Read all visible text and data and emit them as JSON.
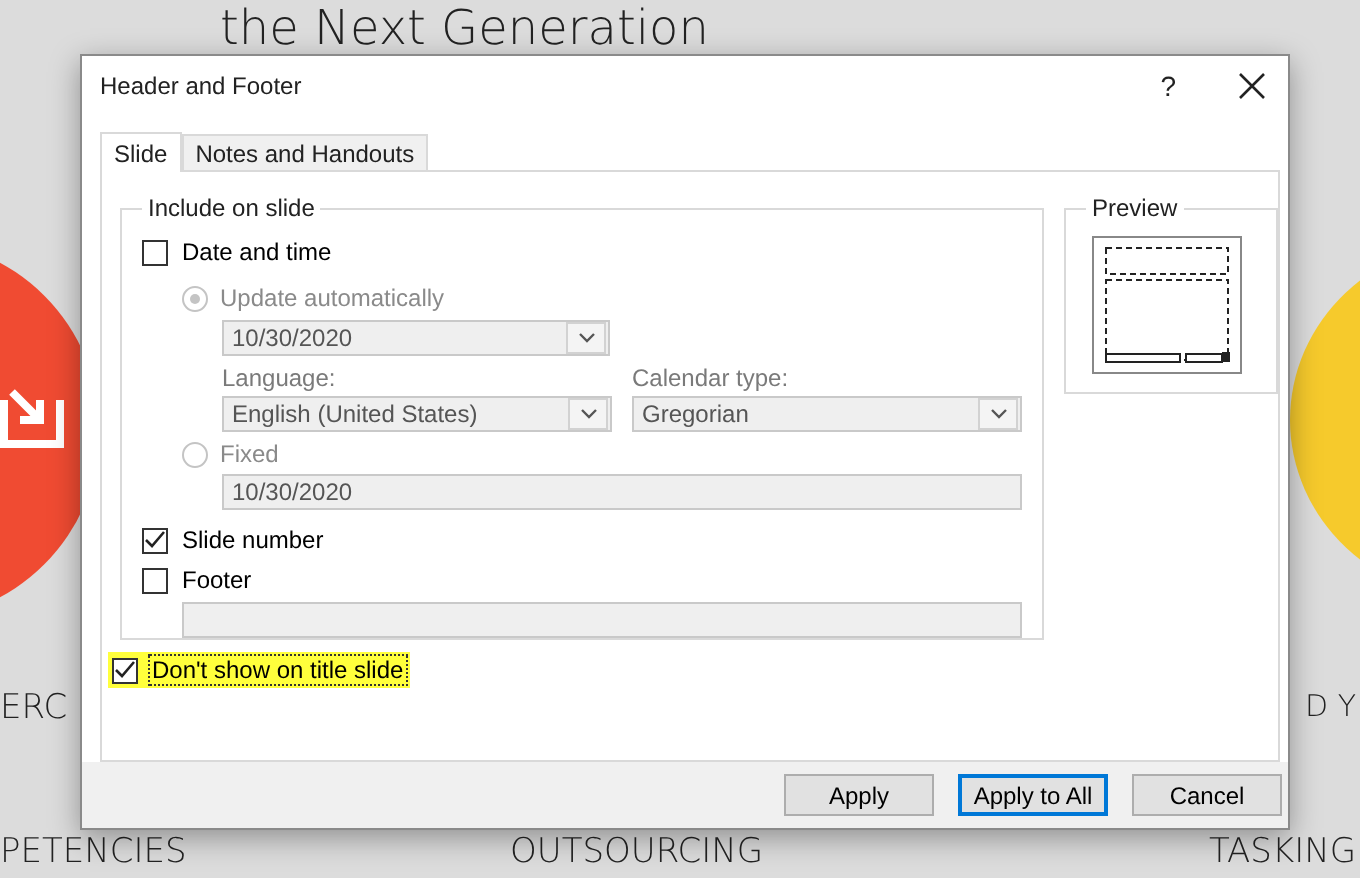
{
  "slide": {
    "title": "the Next Generation",
    "circles": [
      {
        "kind": "left",
        "color": "#f04b32"
      },
      {
        "kind": "right",
        "color": "#f6ca2c"
      }
    ],
    "texts": [
      {
        "kind": "left_top",
        "text": "ERC"
      },
      {
        "kind": "left_bottom",
        "text": "PETENCIES"
      },
      {
        "kind": "center_bottom",
        "text": "OUTSOURCING"
      },
      {
        "kind": "right_top",
        "text": "D Y"
      },
      {
        "kind": "right_bottom",
        "text": "TASKING"
      }
    ]
  },
  "dialog": {
    "title": "Header and Footer",
    "help": "?",
    "tabs": [
      {
        "label": "Slide",
        "selected": true
      },
      {
        "label": "Notes and Handouts",
        "selected": false
      }
    ],
    "include_group": {
      "title": "Include on slide",
      "date_and_time": {
        "label": "Date and time",
        "checked": false
      },
      "update_automatically": {
        "label": "Update automatically",
        "selected": true
      },
      "date_format": {
        "value": "10/30/2020"
      },
      "language": {
        "label": "Language:",
        "value": "English (United States)"
      },
      "calendar_type": {
        "label": "Calendar type:",
        "value": "Gregorian"
      },
      "fixed": {
        "label": "Fixed",
        "selected": false
      },
      "fixed_date": {
        "value": "10/30/2020"
      },
      "slide_number": {
        "label": "Slide number",
        "checked": true
      },
      "footer": {
        "label": "Footer",
        "checked": false
      }
    },
    "preview": {
      "title": "Preview"
    },
    "dont_show_on_title_slide": {
      "label": "Don't show on title slide",
      "checked": true,
      "highlighted": true
    },
    "buttons": [
      {
        "label": "Apply",
        "default": false
      },
      {
        "label": "Apply to All",
        "default": true
      },
      {
        "label": "Cancel",
        "default": false
      }
    ]
  }
}
